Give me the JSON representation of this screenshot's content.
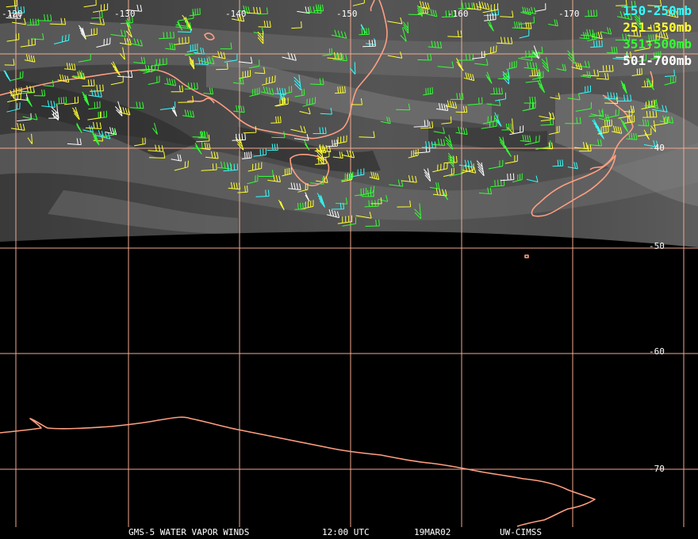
{
  "longitude_labels": [
    "-120",
    "-130",
    "-140",
    "-150",
    "-160",
    "-170"
  ],
  "latitude_labels": [
    "-40",
    "-50",
    "-60",
    "-70"
  ],
  "legend": [
    {
      "label": "150-250mb",
      "color": "#33ffff"
    },
    {
      "label": "251-350mb",
      "color": "#ffff33"
    },
    {
      "label": "351-500mb",
      "color": "#33ff33"
    },
    {
      "label": "501-700mb",
      "color": "#ffffff"
    }
  ],
  "footer": {
    "satellite": "GMS-5 WATER VAPOR WINDS",
    "time": "12:00 UTC",
    "date": "19MAR02",
    "credit": "UW-CIMSS"
  },
  "colors": {
    "grid": "#f2a98e",
    "coast": "#ff9e80",
    "background": "#000000"
  }
}
